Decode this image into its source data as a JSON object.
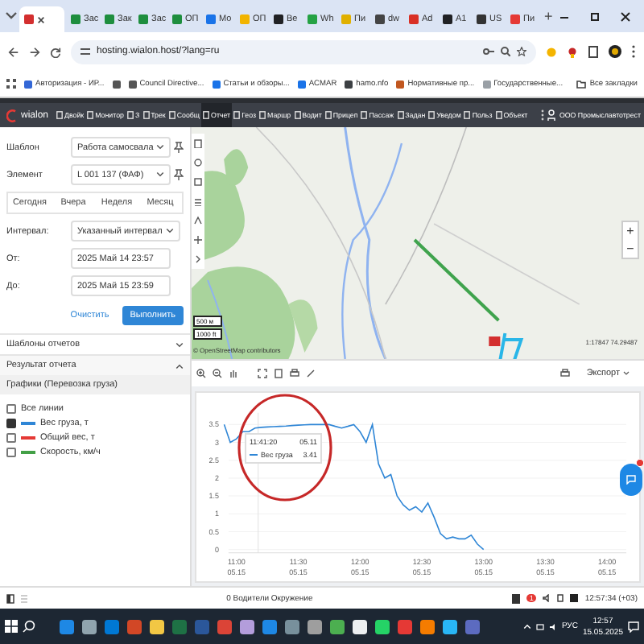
{
  "browser": {
    "tabs": [
      {
        "selected": true,
        "color": "#d32f2f"
      },
      {
        "label": "Зас",
        "selected": false,
        "color": "#1e8e3e"
      },
      {
        "label": "Зак",
        "selected": false,
        "color": "#1e8e3e"
      },
      {
        "label": "Зас",
        "selected": false,
        "color": "#1e8e3e"
      },
      {
        "label": "ОП",
        "selected": false,
        "color": "#1e8e3e"
      },
      {
        "label": "Мо",
        "selected": false,
        "color": "#1a73e8"
      },
      {
        "label": "ОП",
        "selected": false,
        "color": "#f2b400"
      },
      {
        "label": "Ве",
        "selected": false,
        "color": "#202124"
      },
      {
        "label": "Wh",
        "selected": false,
        "color": "#25a244"
      },
      {
        "label": "Пи",
        "selected": false,
        "color": "#e0b000"
      },
      {
        "label": "dw",
        "selected": false,
        "color": "#444444"
      },
      {
        "label": "Ad",
        "selected": false,
        "color": "#d93025"
      },
      {
        "label": "А1",
        "selected": false,
        "color": "#202124"
      },
      {
        "label": "US",
        "selected": false,
        "color": "#333333"
      },
      {
        "label": "Пи",
        "selected": false,
        "color": "#e53935"
      }
    ],
    "new_tab": "+",
    "address": "hosting.wialon.host/?lang=ru",
    "bookmarks": [
      {
        "label": "Авторизация - ИР...",
        "color": "#3367d6"
      },
      {
        "color": "#555555"
      },
      {
        "label": "Council Directive...",
        "color": "#555555"
      },
      {
        "label": "Статьи и обзоры...",
        "color": "#1a73e8"
      },
      {
        "label": "ACMAR",
        "color": "#1a73e8"
      },
      {
        "label": "hamo.nfo",
        "color": "#3c4043"
      },
      {
        "label": "Нормативные пр...",
        "color": "#c1571f"
      },
      {
        "label": "Государственные...",
        "color": "#9aa0a6"
      }
    ],
    "all_bookmarks": "Все закладки"
  },
  "app_nav": {
    "logo": "wialon",
    "items": [
      {
        "label": "Двойк",
        "selected": false
      },
      {
        "label": "Монитор",
        "selected": false
      },
      {
        "label": "З",
        "selected": false
      },
      {
        "label": "Трек",
        "selected": false
      },
      {
        "label": "Сообщ",
        "selected": false
      },
      {
        "label": "Отчет",
        "selected": true
      },
      {
        "label": "Геоз",
        "selected": false
      },
      {
        "label": "Маршр",
        "selected": false
      },
      {
        "label": "Водит",
        "selected": false
      },
      {
        "label": "Прицеп",
        "selected": false
      },
      {
        "label": "Пассаж",
        "selected": false
      },
      {
        "label": "Задан",
        "selected": false
      },
      {
        "label": "Уведом",
        "selected": false
      },
      {
        "label": "Польз",
        "selected": false
      },
      {
        "label": "Объект",
        "selected": false
      }
    ],
    "account": "ООО Промыславтотрест"
  },
  "report_panel": {
    "fields": [
      {
        "label": "Шаблон",
        "value": "Работа самосвала"
      },
      {
        "label": "Элемент",
        "value": "L 001 137 (ФАФ)"
      }
    ],
    "periods": [
      {
        "label": "Сегодня",
        "selected": false
      },
      {
        "label": "Вчера",
        "selected": false
      },
      {
        "label": "Неделя",
        "selected": false
      },
      {
        "label": "Месяц",
        "selected": false
      }
    ],
    "interval": {
      "label": "Интервал:",
      "value": "Указанный интервал"
    },
    "dates": [
      {
        "label": "От:",
        "value": "2025 Май 14 23:57"
      },
      {
        "label": "До:",
        "value": "2025 Май 15 23:59"
      }
    ],
    "buttons": [
      {
        "label": "Очистить",
        "kind": "secondary"
      },
      {
        "label": "Выполнить",
        "kind": "primary"
      }
    ],
    "sections": [
      {
        "label": "Шаблоны отчетов",
        "expanded": false
      },
      {
        "label": "Результат отчета",
        "expanded": true
      }
    ],
    "results": [
      {
        "label": "Графики (Перевозка груза)",
        "selected": true
      }
    ],
    "lines": [
      {
        "label": "Все линии",
        "checked": false
      },
      {
        "label": "Вес груза, т",
        "checked": true,
        "color": "#2f86d6"
      },
      {
        "label": "Общий вес, т",
        "checked": false,
        "color": "#e53935"
      },
      {
        "label": "Скорость, км/ч",
        "checked": false,
        "color": "#43a047"
      }
    ]
  },
  "map": {
    "zoom_in": "+",
    "zoom_out": "−",
    "scale_labels": [
      "500 м",
      "1000 ft"
    ],
    "attribution": "© OpenStreetMap contributors",
    "coordinates": "1:17847  74.29487"
  },
  "chart_toolbar": {
    "export": "Экспорт"
  },
  "chart": {
    "chart_data": {
      "type": "line",
      "categories": [
        null,
        null,
        "11:00 05.15",
        null,
        null,
        null,
        null,
        null,
        null,
        null,
        null,
        null,
        "11:30 05.15",
        null,
        null,
        null,
        null,
        null,
        null,
        null,
        null,
        null,
        "12:00 05.15",
        null,
        null,
        null,
        null,
        null,
        null,
        null,
        null,
        null,
        "12:30 05.15",
        null,
        null,
        null,
        null,
        null,
        null,
        null,
        null,
        null,
        "13:00 05.15",
        null,
        null,
        null,
        null,
        null,
        null,
        null,
        null,
        null,
        "13:30 05.15",
        null,
        null,
        null,
        null,
        null,
        null,
        null,
        null,
        null,
        "14:00 05.15"
      ],
      "series": [
        {
          "color": "#2f86d6",
          "values": [
            3.5,
            3.0,
            3.1,
            3.3,
            3.3,
            3.4,
            3.42,
            3.43,
            3.44,
            3.45,
            3.46,
            3.47,
            3.48,
            3.49,
            3.5,
            3.5,
            3.5,
            3.5,
            3.45,
            3.4,
            3.45,
            3.5,
            3.3,
            3.0,
            3.5,
            2.4,
            2.0,
            2.1,
            1.5,
            1.25,
            1.1,
            1.2,
            1.05,
            1.3,
            0.9,
            0.45,
            0.3,
            0.35,
            0.3,
            0.3,
            0.4,
            0.15,
            0.0,
            null,
            null,
            null,
            null,
            null,
            null,
            null,
            null,
            null,
            null,
            null,
            null,
            null,
            null,
            null,
            null,
            null,
            null,
            null,
            null
          ]
        }
      ],
      "grid": true,
      "ylim": [
        0,
        3.5
      ],
      "yticks": [
        {
          "value": 0,
          "label": "0"
        },
        {
          "value": 0.5,
          "label": "0.5"
        },
        {
          "value": 1,
          "label": "1"
        },
        {
          "value": 1.5,
          "label": "1.5"
        },
        {
          "value": 2,
          "label": "2"
        },
        {
          "value": 2.5,
          "label": "2.5"
        },
        {
          "value": 3,
          "label": "3"
        },
        {
          "value": 3.5,
          "label": "3.5"
        }
      ]
    },
    "tooltip": {
      "time": "11:41:20",
      "date": "05.11",
      "series": "Вес груза",
      "value": "3.41"
    },
    "marked_area": {
      "kind": "circle"
    }
  },
  "status_bar": {
    "text": "0 Водители Окружение",
    "alert_count": "1",
    "time": "12:57:34 (+03)"
  },
  "taskbar": {
    "apps": [
      {
        "color": "#1e88e5"
      },
      {
        "color": "#90a4ae"
      },
      {
        "color": "#0078d4"
      },
      {
        "color": "#d24726"
      },
      {
        "color": "#f2c744"
      },
      {
        "color": "#1e7145"
      },
      {
        "color": "#2b579a"
      },
      {
        "color": "#db4437"
      },
      {
        "color": "#b39ddb"
      },
      {
        "color": "#1e88e5"
      },
      {
        "color": "#78909c"
      },
      {
        "color": "#9e9e9e"
      },
      {
        "color": "#4caf50"
      },
      {
        "color": "#eceff1"
      },
      {
        "color": "#25d366"
      },
      {
        "color": "#e53935"
      },
      {
        "color": "#f57c00"
      },
      {
        "color": "#29b6f6"
      },
      {
        "color": "#5c6bc0"
      }
    ],
    "language": "РУС",
    "time": "12:57",
    "date": "15.05.2025"
  }
}
